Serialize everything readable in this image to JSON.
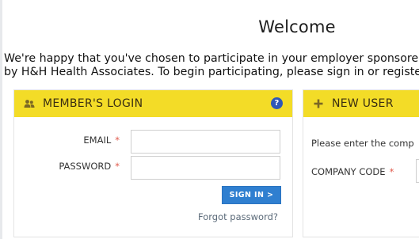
{
  "welcome": {
    "title": "Welcome",
    "intro_line1": "We're happy that you've chosen to participate in your employer sponsore",
    "intro_line2": "by H&H Health Associates. To begin participating, please sign in or registe"
  },
  "member_login": {
    "header": "MEMBER'S LOGIN",
    "help_icon": "question-circle-icon",
    "email_label": "EMAIL",
    "password_label": "PASSWORD",
    "required_marker": "*",
    "email_value": "",
    "password_value": "",
    "signin_label": "SIGN IN >",
    "forgot_label": "Forgot password?"
  },
  "new_user": {
    "header": "NEW USER",
    "header_icon": "plus-icon",
    "prompt": "Please enter the comp",
    "company_code_label": "COMPANY CODE",
    "required_marker": "*"
  },
  "colors": {
    "header_bg": "#f3dc27",
    "signin_bg": "#2f7fd0",
    "help_icon_bg": "#2e57b8",
    "required": "#e0594b"
  }
}
